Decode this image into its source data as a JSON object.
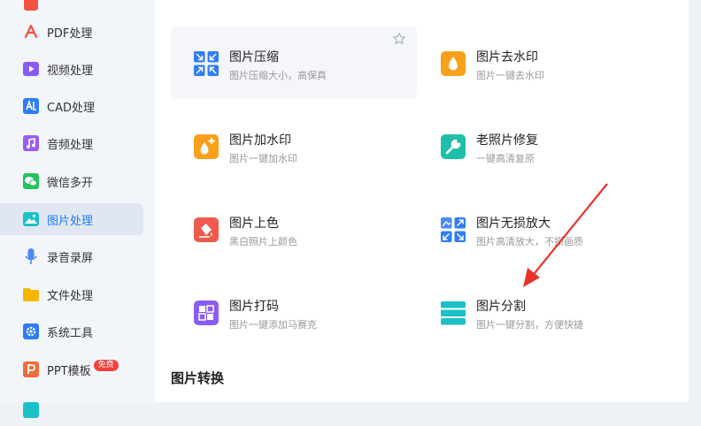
{
  "sidebar": {
    "items": [
      {
        "label": "PDF处理",
        "icon": "pdf-icon",
        "color": "#f2543d"
      },
      {
        "label": "视频处理",
        "icon": "video-icon",
        "color": "#8a5cf6"
      },
      {
        "label": "CAD处理",
        "icon": "cad-icon",
        "color": "#2f7cf6"
      },
      {
        "label": "音频处理",
        "icon": "music-icon",
        "color": "#9b5cf0"
      },
      {
        "label": "微信多开",
        "icon": "wechat-icon",
        "color": "#22c35e"
      },
      {
        "label": "图片处理",
        "icon": "image-icon",
        "color": "#1bc0c8"
      },
      {
        "label": "录音录屏",
        "icon": "microphone-icon",
        "color": "#4a8af4"
      },
      {
        "label": "文件处理",
        "icon": "folder-icon",
        "color": "#f7b500"
      },
      {
        "label": "系统工具",
        "icon": "gear-icon",
        "color": "#2f7cf6"
      },
      {
        "label": "PPT模板",
        "icon": "ppt-icon",
        "color": "#f26b3a",
        "badge": "免费"
      }
    ],
    "active": "图片处理"
  },
  "tools": [
    {
      "title": "图片压缩",
      "desc": "图片压缩大小，高保真",
      "icon": "compress-icon"
    },
    {
      "title": "图片去水印",
      "desc": "图片一键去水印",
      "icon": "remove-watermark-icon"
    },
    {
      "title": "图片加水印",
      "desc": "图片一键加水印",
      "icon": "add-watermark-icon"
    },
    {
      "title": "老照片修复",
      "desc": "一键高清复原",
      "icon": "repair-icon"
    },
    {
      "title": "图片上色",
      "desc": "黑白照片上颜色",
      "icon": "colorize-icon"
    },
    {
      "title": "图片无损放大",
      "desc": "图片高清放大，不损画质",
      "icon": "enlarge-icon"
    },
    {
      "title": "图片打码",
      "desc": "图片一键添加马赛克",
      "icon": "mosaic-icon"
    },
    {
      "title": "图片分割",
      "desc": "图片一键分割，方便快捷",
      "icon": "split-icon"
    }
  ],
  "section": {
    "title": "图片转换"
  },
  "colors": {
    "accent": "#1e7fff",
    "arrow": "#e8322b"
  }
}
